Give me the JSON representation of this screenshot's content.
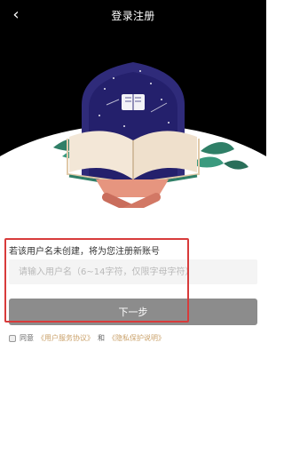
{
  "header": {
    "title": "登录注册",
    "back_icon": "chevron-left-icon"
  },
  "form": {
    "hint": "若该用户名未创建，将为您注册新账号",
    "username_placeholder": "请输入用户名（6~14字符，仅限字母字符）",
    "next_button": "下一步"
  },
  "agreement": {
    "prefix": "同意",
    "user_agreement": "《用户服务协议》",
    "and": "和",
    "privacy_policy": "《隐私保护说明》"
  },
  "colors": {
    "header_bg": "#000000",
    "button_bg": "#8c8c8c",
    "highlight": "#d83b3b",
    "link": "#caa16a"
  }
}
